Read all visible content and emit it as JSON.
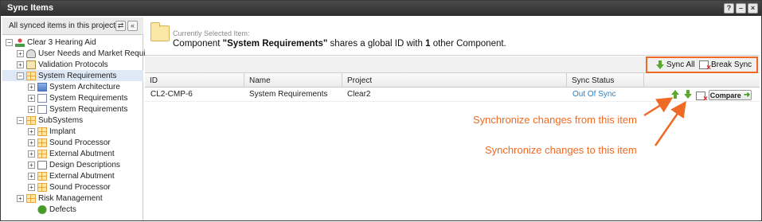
{
  "window": {
    "title": "Sync Items",
    "buttons": [
      "?",
      "–",
      "×"
    ]
  },
  "left_panel": {
    "filter_label": "All synced items in this project",
    "filter_buttons": [
      "⇄",
      "«"
    ],
    "tree": [
      {
        "label": "Clear 3 Hearing Aid",
        "icon": "org-icon",
        "expander": "−",
        "selected": false
      },
      {
        "label": "User Needs and Market Require",
        "icon": "person-icon",
        "expander": "+",
        "selected": false
      },
      {
        "label": "Validation Protocols",
        "icon": "checklist-icon",
        "expander": "+",
        "selected": false
      },
      {
        "label": "System Requirements",
        "icon": "grid-icon",
        "expander": "−",
        "selected": true
      },
      {
        "label": "System Architecture",
        "icon": "document-blue-icon",
        "expander": "+",
        "selected": false
      },
      {
        "label": "System Requirements",
        "icon": "document-icon",
        "expander": "+",
        "selected": false
      },
      {
        "label": "System Requirements",
        "icon": "document-icon",
        "expander": "+",
        "selected": false
      },
      {
        "label": "SubSystems",
        "icon": "grid-icon",
        "expander": "−",
        "selected": false
      },
      {
        "label": "Implant",
        "icon": "grid-icon",
        "expander": "+",
        "selected": false
      },
      {
        "label": "Sound Processor",
        "icon": "grid-icon",
        "expander": "+",
        "selected": false
      },
      {
        "label": "External Abutment",
        "icon": "grid-icon",
        "expander": "+",
        "selected": false
      },
      {
        "label": "Design Descriptions",
        "icon": "folder-icon",
        "expander": "+",
        "selected": false
      },
      {
        "label": "External Abutment",
        "icon": "grid-icon",
        "expander": "+",
        "selected": false
      },
      {
        "label": "Sound Processor",
        "icon": "grid-icon",
        "expander": "+",
        "selected": false
      },
      {
        "label": "Risk Management",
        "icon": "grid-icon",
        "expander": "+",
        "selected": false
      },
      {
        "label": "Defects",
        "icon": "bug-icon",
        "expander": "",
        "selected": false
      }
    ]
  },
  "info": {
    "current_label": "Currently Selected Item:",
    "msg_prefix": "Component ",
    "msg_item": "\"System Requirements\"",
    "msg_middle": " shares a global ID with ",
    "msg_count": "1",
    "msg_suffix": " other Component."
  },
  "toolbar": {
    "sync_all": "Sync All",
    "break_sync": "Break Sync",
    "highlight_color": "#ef6a24"
  },
  "grid": {
    "headers": [
      "ID",
      "Name",
      "Project",
      "Sync Status"
    ],
    "rows": [
      {
        "id": "CL2-CMP-6",
        "name": "System Requirements",
        "project": "Clear2",
        "status": "Out Of Sync",
        "compare": "Compare"
      }
    ]
  },
  "annotations": {
    "from_item": "Synchronize changes from this item",
    "to_item": "Synchronize changes to this item",
    "color": "#ef6a24"
  }
}
